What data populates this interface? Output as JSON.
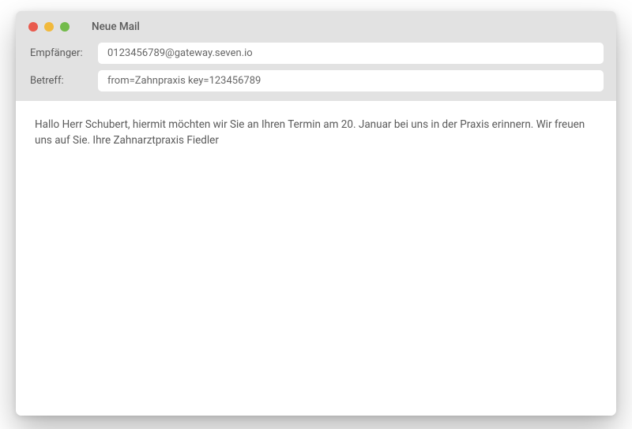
{
  "window": {
    "title": "Neue Mail"
  },
  "fields": {
    "recipient": {
      "label": "Empfänger:",
      "value": "0123456789@gateway.seven.io"
    },
    "subject": {
      "label": "Betreff:",
      "value": "from=Zahnpraxis key=123456789"
    }
  },
  "body": "Hallo Herr Schubert, hiermit möchten wir Sie an Ihren Termin am 20. Januar bei uns in der Praxis erinnern. Wir freuen uns auf Sie. Ihre Zahnarztpraxis Fiedler"
}
